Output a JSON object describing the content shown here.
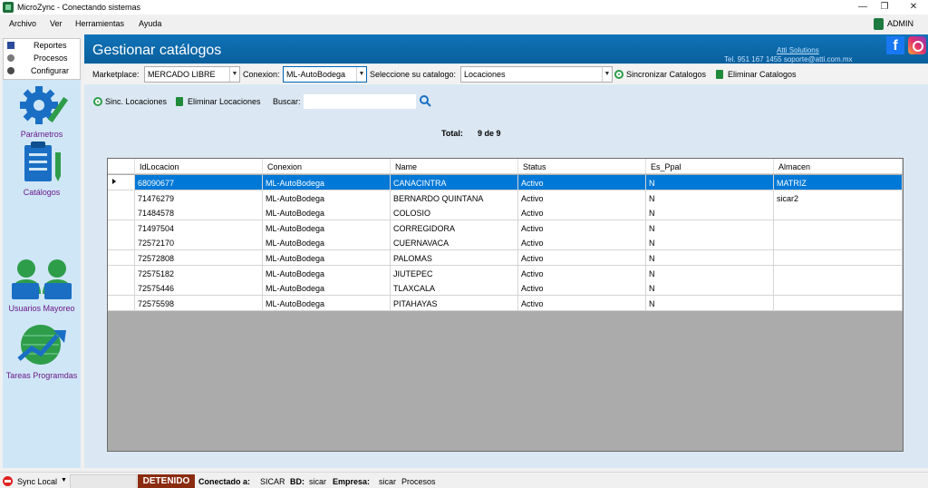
{
  "window": {
    "title": "MicroZync - Conectando sistemas",
    "controls": [
      "—",
      "❐",
      "✕"
    ]
  },
  "menu": {
    "items": [
      "Archivo",
      "Ver",
      "Herramientas",
      "Ayuda"
    ],
    "user": "ADMIN"
  },
  "nav": {
    "tree": [
      "Reportes",
      "Procesos",
      "Configurar"
    ],
    "modules": [
      "Parámetros",
      "Catálogos",
      "Usuarios Mayoreo",
      "Tareas Programdas"
    ]
  },
  "header": {
    "title": "Gestionar catálogos",
    "company": "Atti Solutions",
    "contact": "Tel. 951 167 1455  soporte@atti.com.mx"
  },
  "toolbar": {
    "marketplace_label": "Marketplace:",
    "marketplace_value": "MERCADO LIBRE",
    "conexion_label": "Conexion:",
    "conexion_value": "ML-AutoBodega",
    "catalogo_label": "Seleccione su catalogo:",
    "catalogo_value": "Locaciones",
    "sync_catalogs": "Sincronizar Catalogos",
    "delete_catalogs": "Eliminar Catalogos",
    "sync_locations": "Sinc. Locaciones",
    "delete_locations": "Eliminar Locaciones",
    "search_label": "Buscar:",
    "search_value": ""
  },
  "summary": {
    "total_label": "Total:",
    "total_value": "9 de 9"
  },
  "grid": {
    "columns": [
      "IdLocacion",
      "Conexion",
      "Name",
      "Status",
      "Es_Ppal",
      "Almacen"
    ],
    "selected_index": 0,
    "rows": [
      [
        "68090677",
        "ML-AutoBodega",
        "CANACINTRA",
        "Activo",
        "N",
        "MATRIZ"
      ],
      [
        "71476279",
        "ML-AutoBodega",
        "BERNARDO QUINTANA",
        "Activo",
        "N",
        "sicar2"
      ],
      [
        "71484578",
        "ML-AutoBodega",
        "COLOSIO",
        "Activo",
        "N",
        ""
      ],
      [
        "71497504",
        "ML-AutoBodega",
        "CORREGIDORA",
        "Activo",
        "N",
        ""
      ],
      [
        "72572170",
        "ML-AutoBodega",
        "CUERNAVACA",
        "Activo",
        "N",
        ""
      ],
      [
        "72572808",
        "ML-AutoBodega",
        "PALOMAS",
        "Activo",
        "N",
        ""
      ],
      [
        "72575182",
        "ML-AutoBodega",
        "JIUTEPEC",
        "Activo",
        "N",
        ""
      ],
      [
        "72575446",
        "ML-AutoBodega",
        "TLAXCALA",
        "Activo",
        "N",
        ""
      ],
      [
        "72575598",
        "ML-AutoBodega",
        "PITAHAYAS",
        "Activo",
        "N",
        ""
      ]
    ]
  },
  "status": {
    "sync_label": "Sync Local",
    "state": "DETENIDO",
    "conectado_label": "Conectado a:",
    "conectado_value": "SICAR",
    "bd_label": "BD:",
    "bd_value": "sicar",
    "empresa_label": "Empresa:",
    "empresa_value": "sicar",
    "procesos": "Procesos"
  },
  "colors": {
    "header": "#0f73b8",
    "selection": "#0078d7",
    "nav": "#cfe6f7",
    "status_badge": "#8b2b0f"
  }
}
